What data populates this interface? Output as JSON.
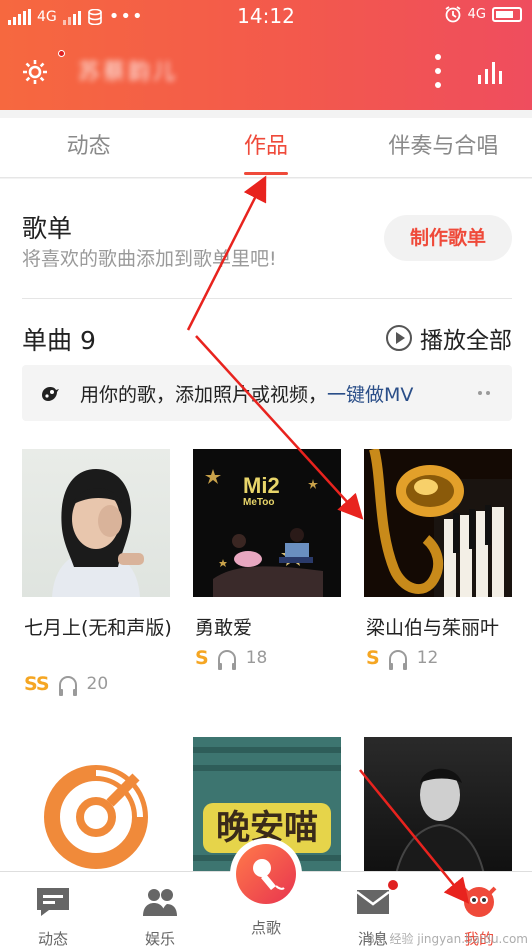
{
  "status_bar": {
    "network_left": "4G",
    "time": "14:12",
    "network_right": "4G"
  },
  "header": {
    "username": "苏蔡韵儿"
  },
  "tabs": [
    {
      "label": "动态",
      "active": false
    },
    {
      "label": "作品",
      "active": true
    },
    {
      "label": "伴奏与合唱",
      "active": false
    }
  ],
  "playlist": {
    "title": "歌单",
    "subtitle": "将喜欢的歌曲添加到歌单里吧!",
    "create_button": "制作歌单"
  },
  "singles": {
    "title": "单曲 9",
    "play_all": "播放全部"
  },
  "mv_banner": {
    "text": "用你的歌，添加照片或视频，",
    "link": "一键做MV"
  },
  "songs": [
    {
      "title": "七月上(无和声版)",
      "grade": "SS",
      "listens": "20"
    },
    {
      "title": "勇敢爱",
      "grade": "S",
      "listens": "18",
      "cover_text": "Mi2 MeToo"
    },
    {
      "title": "梁山伯与茱丽叶",
      "grade": "S",
      "listens": "12"
    },
    {
      "title": "",
      "grade": "",
      "listens": ""
    },
    {
      "title": "",
      "grade": "",
      "listens": "",
      "cover_text": "晚安喵"
    },
    {
      "title": "",
      "grade": "",
      "listens": ""
    }
  ],
  "bottom_nav": [
    {
      "label": "动态",
      "icon": "chat-icon"
    },
    {
      "label": "娱乐",
      "icon": "people-icon"
    },
    {
      "label": "点歌",
      "icon": "mic-icon"
    },
    {
      "label": "消息",
      "icon": "mail-icon"
    },
    {
      "label": "我的",
      "icon": "profile-icon",
      "active": true
    }
  ],
  "watermark": "Bai 经验 jingyan.baidu.com",
  "colors": {
    "accent": "#ef4a3a",
    "header_start": "#f6683f",
    "header_end": "#ef4d5e",
    "grade": "#f5a623",
    "link": "#2a4e88"
  }
}
